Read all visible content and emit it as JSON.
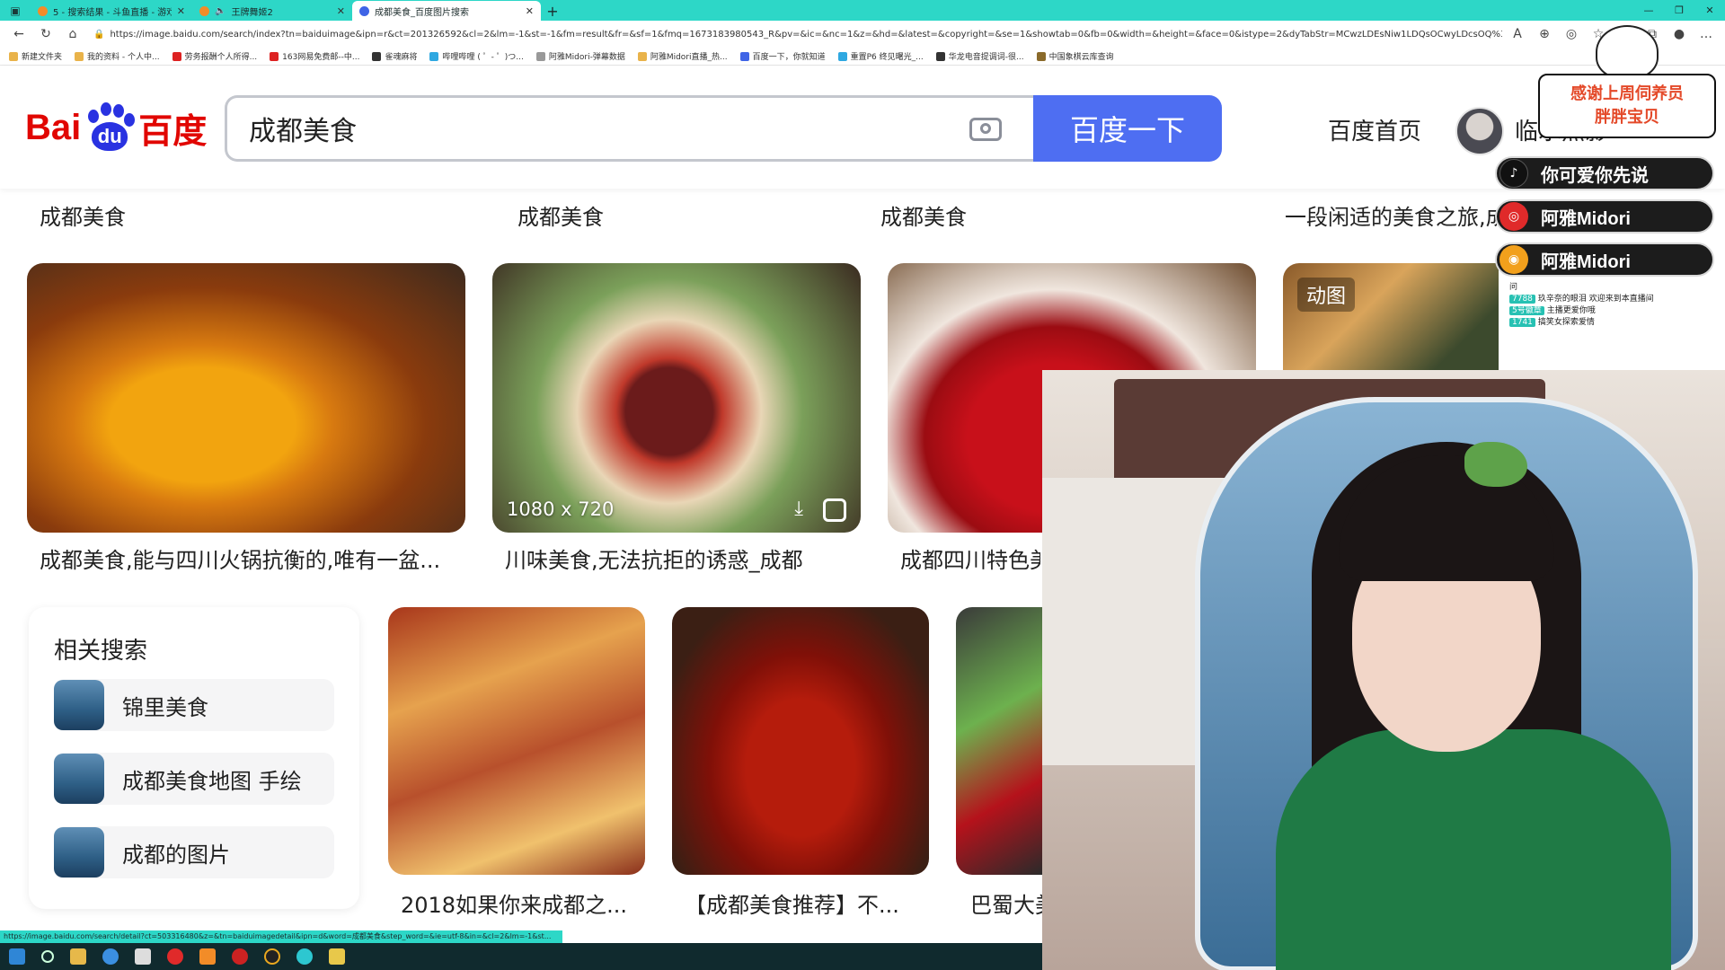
{
  "browser": {
    "tabs": [
      {
        "title": "5 - 搜索结果 - 斗鱼直播 - 游戏直...",
        "active": false
      },
      {
        "title": "王牌舞姬2",
        "active": false
      },
      {
        "title": "成都美食_百度图片搜索",
        "active": true
      }
    ],
    "new_tab": "+",
    "url": "https://image.baidu.com/search/index?tn=baiduimage&ipn=r&ct=201326592&cl=2&lm=-1&st=-1&fm=result&fr=&sf=1&fmq=1673183980543_R&pv=&ic=&nc=1&z=&hd=&latest=&copyright=&se=1&showtab=0&fb=0&width=&height=&face=0&istype=2&dyTabStr=MCwzLDEsNiw1LDQsOCwyLDcsOQ%3D%3D&...",
    "bookmarks": [
      "新建文件夹",
      "我的资料 - 个人中...",
      "劳务报酬个人所得...",
      "163网易免费邮--中...",
      "雀魂麻将",
      "哔哩哔哩 ( ゜- ゜)つ...",
      "阿雅Midori-弹幕数据",
      "阿雅Midori直播_热...",
      "百度一下，你就知道",
      "重置P6 终见曙光_...",
      "华龙电音提调词-很...",
      "中国象棋云库查询"
    ]
  },
  "header": {
    "logo_bai": "Bai",
    "logo_du": "du",
    "logo_cn": "百度",
    "search_query": "成都美食",
    "search_button": "百度一下",
    "home_link": "百度首页",
    "username": "临水照影"
  },
  "top_captions": [
    "成都美食",
    "成都美食",
    "成都美食",
    "一段闲适的美食之旅,成"
  ],
  "row2": [
    {
      "caption": "成都美食,能与四川火锅抗衡的,唯有一盆..."
    },
    {
      "caption": "川味美食,无法抗拒的诱惑_成都",
      "dimensions": "1080 x 720"
    },
    {
      "caption": "成都四川特色美"
    },
    {
      "badge": "动图"
    }
  ],
  "related": {
    "title": "相关搜索",
    "items": [
      "锦里美食",
      "成都美食地图 手绘",
      "成都的图片"
    ]
  },
  "row3": [
    {
      "caption": "2018如果你来成都之..."
    },
    {
      "caption": "【成都美食推荐】不..."
    },
    {
      "caption": "巴蜀大美"
    }
  ],
  "status_url": "https://image.baidu.com/search/detail?ct=503316480&z=&tn=baiduimagedetail&ipn=d&word=成都美食&step_word=&ie=utf-8&in=&cl=2&lm=-1&st...",
  "stream_overlay": {
    "thanks_line1": "感谢上周伺养员",
    "thanks_line2": "胖胖宝贝",
    "socials": [
      {
        "icon": "tiktok-icon",
        "label": "你可爱你先说",
        "color": "#111111"
      },
      {
        "icon": "netease-music-icon",
        "label": "阿雅Midori",
        "color": "#e02a2a"
      },
      {
        "icon": "weibo-icon",
        "label": "阿雅Midori",
        "color": "#f2a01c"
      }
    ],
    "chat_lines": [
      {
        "tag": "",
        "text": "问"
      },
      {
        "tag": "7788",
        "text": "玖辛奈的眼泪 欢迎来到本直播间"
      },
      {
        "tag": "5号徽章",
        "text": "主播更爱你哦"
      },
      {
        "tag": "1741",
        "text": "搞笑女探索爱情"
      }
    ]
  }
}
